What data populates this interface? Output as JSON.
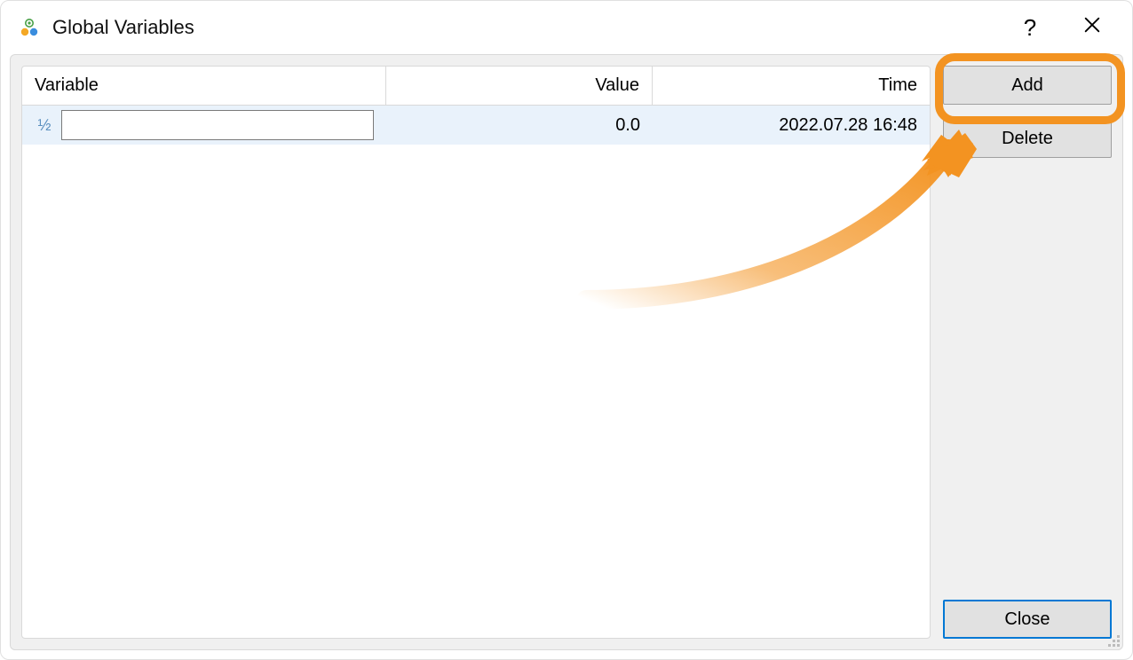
{
  "titlebar": {
    "title": "Global Variables",
    "help_label": "?",
    "close_label": "Close window"
  },
  "columns": {
    "variable": "Variable",
    "value": "Value",
    "time": "Time"
  },
  "rows": [
    {
      "icon_text": "½",
      "variable_value": "",
      "value": "0.0",
      "time": "2022.07.28 16:48"
    }
  ],
  "buttons": {
    "add": "Add",
    "delete": "Delete",
    "close": "Close"
  }
}
